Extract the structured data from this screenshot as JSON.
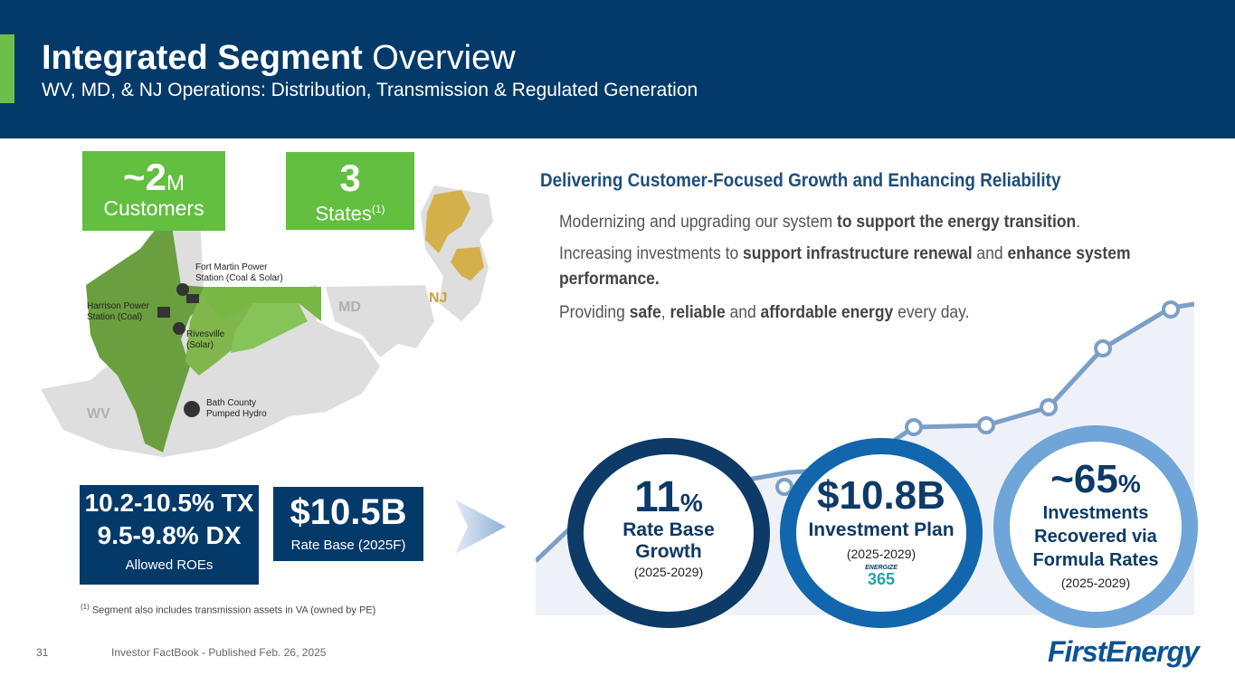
{
  "header": {
    "title_bold": "Integrated Segment",
    "title_rest": " Overview",
    "subtitle": "WV, MD, & NJ Operations: Distribution, Transmission & Regulated Generation"
  },
  "stats": {
    "customers_value": "~2",
    "customers_unit": "M",
    "customers_label": "Customers",
    "states_value": "3",
    "states_label": "States",
    "states_footnote_ref": "(1)"
  },
  "map": {
    "wv": "WV",
    "md": "MD",
    "nj": "NJ",
    "fort_martin": "Fort Martin Power\nStation (Coal & Solar)",
    "harrison": "Harrison Power\nStation (Coal)",
    "rivesville": "Rivesville\n(Solar)",
    "bath_county": "Bath County\nPumped Hydro"
  },
  "roe": {
    "tx": "10.2-10.5% TX",
    "dx": "9.5-9.8% DX",
    "label": "Allowed ROEs"
  },
  "rate_base": {
    "value": "$10.5B",
    "label": "Rate Base (2025F)"
  },
  "footnote": {
    "ref": "(1)",
    "text": " Segment also includes transmission assets in VA (owned by PE)"
  },
  "right": {
    "heading": "Delivering Customer-Focused Growth and Enhancing Reliability",
    "b1_pre": "Modernizing and upgrading our system ",
    "b1_bold": "to support the energy transition",
    "b1_post": ".",
    "b2_pre": "Increasing investments to ",
    "b2_bold1": "support infrastructure renewal",
    "b2_mid": " and ",
    "b2_bold2": "enhance system performance.",
    "b3_pre": "Providing ",
    "b3_bold1": "safe",
    "b3_mid1": ", ",
    "b3_bold2": "reliable",
    "b3_mid2": " and ",
    "b3_bold3": "affordable energy",
    "b3_post": " every day."
  },
  "circles": [
    {
      "value": "11",
      "unit": "%",
      "label": "Rate Base\nGrowth",
      "period": "(2025-2029)"
    },
    {
      "value": "$10.8B",
      "label": "Investment Plan",
      "period": "(2025-2029)",
      "badge_top": "ENERGIZE",
      "badge_num": "365"
    },
    {
      "value": "~65",
      "unit": "%",
      "label": "Investments\nRecovered via\nFormula Rates",
      "period": "(2025-2029)"
    }
  ],
  "footer": {
    "page": "31",
    "source": "Investor FactBook - Published Feb. 26, 2025",
    "logo": "FirstEnergy"
  },
  "colors": {
    "navy": "#043a6a",
    "green": "#62bf3f",
    "gold": "#d4b04a",
    "light_blue": "#6fa5d8",
    "mid_blue": "#1266ad"
  }
}
